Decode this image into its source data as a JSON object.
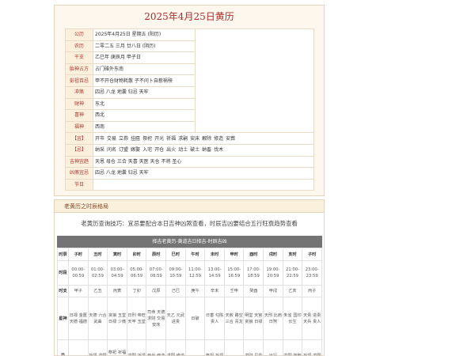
{
  "title": "2025年4月25日黄历",
  "info": {
    "gongli": {
      "label": "公历",
      "value": "2025年4月25日 星期五 (阳历)"
    },
    "nongli": {
      "label": "农历",
      "value": "二零二五 三月 廿八日 (阴历)"
    },
    "ganzhi": {
      "label": "干支",
      "value": "乙巳年 庚辰月 甲子日"
    },
    "taishen": {
      "label": "胎神占方",
      "value": "占门碓外东南"
    },
    "pengzu": {
      "label": "彭祖百忌",
      "value": "甲不开仓财物耗散 子不问卜自惹祸殃"
    },
    "chongsha": {
      "label": "冲煞",
      "value": "四忌 八龙 地囊 归忌 天牢"
    },
    "caishen": {
      "label": "财神",
      "value": "东北"
    },
    "xishen": {
      "label": "喜神",
      "value": "西北"
    },
    "fushen": {
      "label": "福神",
      "value": "西南"
    },
    "yi": {
      "label": "【宜】",
      "items": [
        "开市",
        "交易",
        "立券",
        "挂匾",
        "祭祀",
        "开光",
        "祈福",
        "求嗣",
        "安床",
        "解除",
        "修造",
        "安葬"
      ]
    },
    "ji": {
      "label": "【忌】",
      "items": [
        "纳采",
        "问名",
        "订盟",
        "嫁娶",
        "入宅",
        "开仓",
        "出火",
        "动土",
        "破土",
        "纳畜",
        "伐木"
      ]
    },
    "jishen": {
      "label": "吉神宜趋",
      "value": "天恩 母仓 三合 天喜 天医 天仓 不将 圣心"
    },
    "xiongshen": {
      "label": "凶煞宜忌",
      "value": "四忌 八龙 地囊 归忌 天牢"
    },
    "jieri": {
      "label": "节日",
      "value": ""
    }
  },
  "shichen": {
    "header": "老黄历之时辰格局",
    "tip": "老黄历查询技巧：宜忌要配合本日吉神凶煞查看，时辰吉凶要结合五行旺衰趋势查看",
    "table_title": "择吉老黄历-黄道吉日择吉-时辰吉凶",
    "rows": {
      "hour": "时辰",
      "time": "时段",
      "shichen": "时支",
      "star": "星神",
      "yi": "宜",
      "ji": "忌"
    },
    "columns": [
      {
        "name": "子时",
        "start": "00:00-",
        "end": "00:59",
        "zhi": "甲子",
        "star": "日禄 金匮 天德 福德",
        "yi": "",
        "ji": ""
      },
      {
        "name": "丑时",
        "start": "01:00-",
        "end": "02:59",
        "zhi": "乙丑",
        "star": "天德 六合 武曲",
        "yi": "",
        "ji": "祈福 求嗣"
      },
      {
        "name": "寅时",
        "start": "03:00-",
        "end": "04:59",
        "zhi": "丙寅",
        "star": "贪狼 玉堂 日禄 少微",
        "yi": "",
        "ji": "祭祀 祈福 求嗣 开光"
      },
      {
        "name": "卯时",
        "start": "05:00-",
        "end": "06:59",
        "zhi": "丁卯",
        "star": "日刑 帝旺 天牢 玉堂",
        "yi": "",
        "ji": "求嗣 祈福"
      },
      {
        "name": "辰时",
        "start": "07:00-",
        "end": "08:59",
        "zhi": "戊辰",
        "star": "司命 天德 求财 交易 安床",
        "yi": "",
        "ji": "开光 修造"
      },
      {
        "name": "巳时",
        "start": "09:00-",
        "end": "10:59",
        "zhi": "己巳",
        "star": "天乙 元武 进贵",
        "yi": "",
        "ji": "求嗣 修造"
      },
      {
        "name": "午时",
        "start": "11:00-",
        "end": "12:59",
        "zhi": "庚午",
        "star": "日破",
        "yi": "",
        "ji": ""
      },
      {
        "name": "未时",
        "start": "13:00-",
        "end": "14:59",
        "zhi": "辛未",
        "star": "日害 勾陈 贵人",
        "yi": "",
        "ji": "祭祀 祈福"
      },
      {
        "name": "申时",
        "start": "15:00-",
        "end": "16:59",
        "zhi": "壬申",
        "star": "天赦 路空 三合 青龙",
        "yi": "",
        "ji": ""
      },
      {
        "name": "酉时",
        "start": "17:00-",
        "end": "18:59",
        "zhi": "癸酉",
        "star": "明堂 天官 贪狼 日禄",
        "yi": "",
        "ji": "求财 见贵"
      },
      {
        "name": "戌时",
        "start": "19:00-",
        "end": "20:59",
        "zhi": "甲戌",
        "star": "天刑 比肩 日煞",
        "yi": "",
        "ji": "出行"
      },
      {
        "name": "亥时",
        "start": "21:00-",
        "end": "22:59",
        "zhi": "乙亥",
        "star": "朱雀 国印 长生",
        "yi": "",
        "ji": "求嗣 嫁娶"
      },
      {
        "name": "子时",
        "start": "23:00-",
        "end": "23:59",
        "zhi": "丙子",
        "star": "天贵 进贵 天兵 贵人",
        "yi": "",
        "ji": "祈福 求嗣"
      }
    ]
  }
}
